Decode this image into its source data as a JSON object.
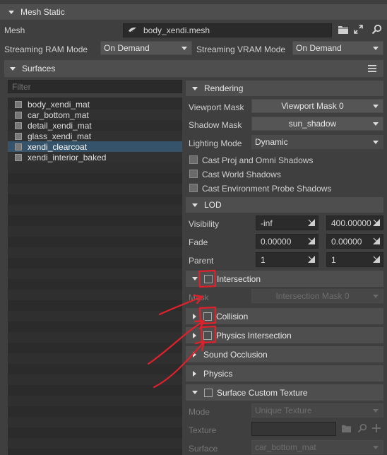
{
  "mesh_static": {
    "title": "Mesh Static",
    "mesh_label": "Mesh",
    "mesh_value": "body_xendi.mesh",
    "streaming_ram_label": "Streaming RAM Mode",
    "streaming_ram_value": "On Demand",
    "streaming_vram_label": "Streaming VRAM Mode",
    "streaming_vram_value": "On Demand"
  },
  "surfaces": {
    "title": "Surfaces",
    "filter_placeholder": "Filter",
    "items": [
      {
        "label": "body_xendi_mat",
        "selected": false
      },
      {
        "label": "car_bottom_mat",
        "selected": false
      },
      {
        "label": "detail_xendi_mat",
        "selected": false
      },
      {
        "label": "glass_xendi_mat",
        "selected": false
      },
      {
        "label": "xendi_clearcoat",
        "selected": true
      },
      {
        "label": "xendi_interior_baked",
        "selected": false
      }
    ]
  },
  "rendering": {
    "title": "Rendering",
    "viewport_mask_label": "Viewport Mask",
    "viewport_mask_value": "Viewport Mask 0",
    "shadow_mask_label": "Shadow Mask",
    "shadow_mask_value": "sun_shadow",
    "lighting_mode_label": "Lighting Mode",
    "lighting_mode_value": "Dynamic",
    "cast_proj_label": "Cast Proj and Omni Shadows",
    "cast_world_label": "Cast World Shadows",
    "cast_env_label": "Cast Environment Probe Shadows"
  },
  "lod": {
    "title": "LOD",
    "visibility_label": "Visibility",
    "visibility_min": "-inf",
    "visibility_max": "400.00000",
    "fade_label": "Fade",
    "fade_min": "0.00000",
    "fade_max": "0.00000",
    "parent_label": "Parent",
    "parent_min": "1",
    "parent_max": "1"
  },
  "intersection": {
    "title": "Intersection",
    "mask_label": "Mask",
    "mask_value": "Intersection Mask 0"
  },
  "collision": {
    "title": "Collision"
  },
  "physics_intersection": {
    "title": "Physics Intersection"
  },
  "sound_occlusion": {
    "title": "Sound Occlusion"
  },
  "physics": {
    "title": "Physics"
  },
  "surface_custom_texture": {
    "title": "Surface Custom Texture",
    "mode_label": "Mode",
    "mode_value": "Unique Texture",
    "texture_label": "Texture",
    "texture_value": "",
    "surface_label": "Surface",
    "surface_value": "car_bottom_mat"
  },
  "colors": {
    "background": "#3f3f3f",
    "header": "#4e4e4e",
    "selection": "#35536a",
    "annotation": "#e0202a"
  }
}
